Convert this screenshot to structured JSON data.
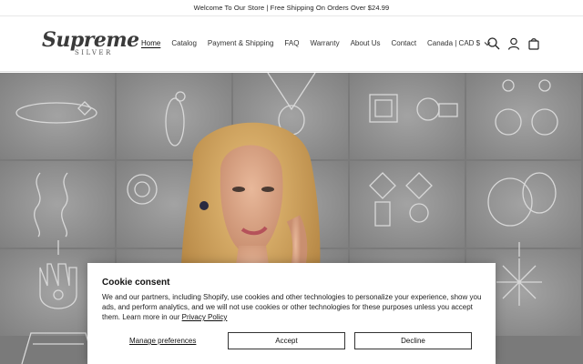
{
  "announcement": {
    "text": "Welcome To Our Store | Free Shipping On Orders Over $24.99"
  },
  "header": {
    "logo_main": "Supreme",
    "logo_sub": "SILVER",
    "nav": [
      {
        "label": "Home",
        "active": true
      },
      {
        "label": "Catalog"
      },
      {
        "label": "Payment & Shipping"
      },
      {
        "label": "FAQ"
      },
      {
        "label": "Warranty"
      },
      {
        "label": "About Us"
      },
      {
        "label": "Contact"
      }
    ],
    "country": "Canada | CAD $",
    "icons": [
      "search-icon",
      "account-icon",
      "cart-icon"
    ]
  },
  "cookie": {
    "title": "Cookie consent",
    "body": "We and our partners, including Shopify, use cookies and other technologies to personalize your experience, show you ads, and perform analytics, and we will not use cookies or other technologies for these purposes unless you accept them. Learn more in our",
    "link": "Privacy Policy",
    "manage_label": "Manage preferences",
    "accept_label": "Accept",
    "decline_label": "Decline"
  }
}
